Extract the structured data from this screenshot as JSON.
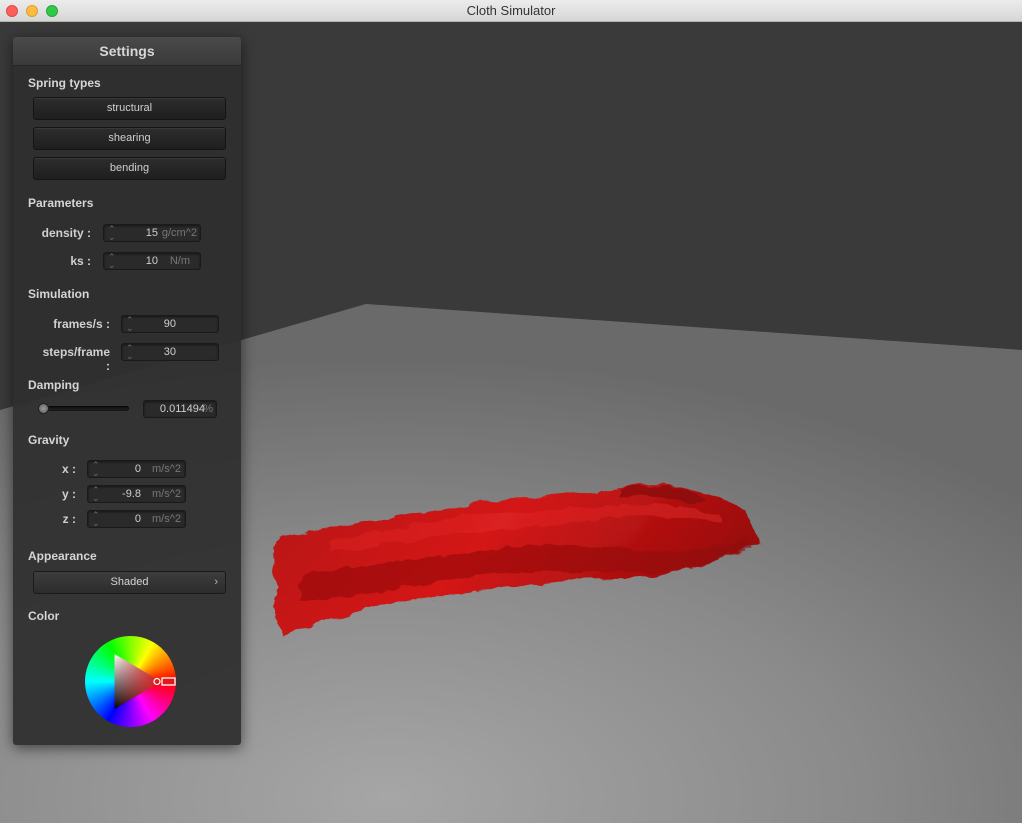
{
  "window": {
    "title": "Cloth Simulator"
  },
  "settings": {
    "title": "Settings",
    "spring_types": {
      "label": "Spring types",
      "buttons": [
        "structural",
        "shearing",
        "bending"
      ]
    },
    "parameters": {
      "label": "Parameters",
      "density": {
        "label": "density :",
        "value": "15",
        "unit": "g/cm^2"
      },
      "ks": {
        "label": "ks :",
        "value": "10",
        "unit": "N/m"
      }
    },
    "simulation": {
      "label": "Simulation",
      "fps": {
        "label": "frames/s :",
        "value": "90"
      },
      "steps": {
        "label": "steps/frame :",
        "value": "30"
      }
    },
    "damping": {
      "label": "Damping",
      "value": "0.011494",
      "unit": "%",
      "slider_fraction": 0.0
    },
    "gravity": {
      "label": "Gravity",
      "x": {
        "label": "x :",
        "value": "0",
        "unit": "m/s^2"
      },
      "y": {
        "label": "y :",
        "value": "-9.8",
        "unit": "m/s^2"
      },
      "z": {
        "label": "z :",
        "value": "0",
        "unit": "m/s^2"
      }
    },
    "appearance": {
      "label": "Appearance",
      "selected": "Shaded"
    },
    "color": {
      "label": "Color",
      "value": "#d01010"
    }
  },
  "colors": {
    "cloth": "#c41414",
    "background": "#3a3a3a",
    "floor": "#8c8c8c"
  },
  "icons": {
    "spinner": "updown-spinner-icon",
    "dropdown": "chevron-right-icon"
  }
}
